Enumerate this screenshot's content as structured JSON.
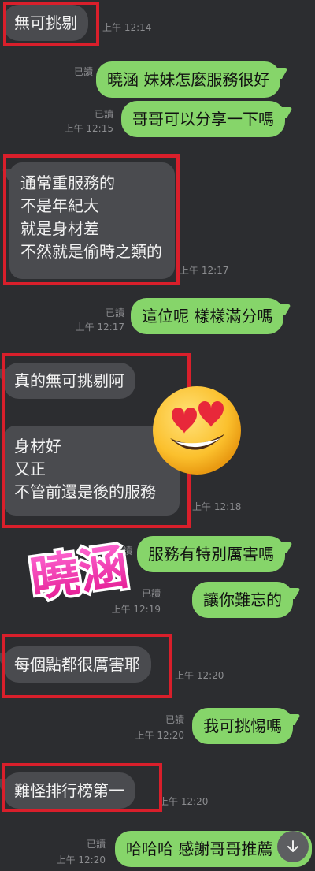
{
  "messages": [
    {
      "id": "m1",
      "side": "in",
      "text": "無可挑剔",
      "time": "上午 12:14"
    },
    {
      "id": "m2",
      "side": "out",
      "text": "曉涵 妹妹怎麼服務很好",
      "read": "已讀"
    },
    {
      "id": "m3",
      "side": "out",
      "text": "哥哥可以分享一下嗎",
      "read": "已讀",
      "time": "上午 12:15"
    },
    {
      "id": "m4",
      "side": "in",
      "lines": [
        "通常重服務的",
        "不是年紀大",
        "就是身材差",
        "不然就是偷時之類的"
      ],
      "time": "上午 12:17"
    },
    {
      "id": "m5",
      "side": "out",
      "text": "這位呢 樣樣滿分嗎",
      "read": "已讀",
      "time": "上午 12:17"
    },
    {
      "id": "m6",
      "side": "in",
      "text": "真的無可挑剔阿"
    },
    {
      "id": "m7",
      "side": "in",
      "lines": [
        "身材好",
        "又正",
        "不管前還是後的服務"
      ],
      "time": "上午 12:18"
    },
    {
      "id": "m8",
      "side": "out",
      "text": "服務有特別厲害嗎",
      "read": "已讀"
    },
    {
      "id": "m9",
      "side": "out",
      "text": "讓你難忘的",
      "read": "已讀",
      "time": "上午 12:19"
    },
    {
      "id": "m10",
      "side": "in",
      "text": "每個點都很厲害耶",
      "time": "上午 12:20"
    },
    {
      "id": "m11",
      "side": "out",
      "text": "我可挑惕嗎",
      "read": "已讀",
      "time": "上午 12:20"
    },
    {
      "id": "m12",
      "side": "in",
      "text": "難怪排行榜第一",
      "time": "上午 12:20"
    },
    {
      "id": "m13",
      "side": "out",
      "text": "哈哈哈 感謝哥哥推薦",
      "read": "已讀",
      "time": "上午 12:20"
    }
  ],
  "sticker": {
    "text": "曉涵"
  },
  "icons": {
    "scroll": "arrow-down-icon",
    "emoji": "heart-eyes-emoji-icon"
  },
  "colors": {
    "outgoing": "#86d56a",
    "incoming": "#4a4b4f",
    "highlight": "#d91f2b",
    "background": "#2c2d30"
  }
}
